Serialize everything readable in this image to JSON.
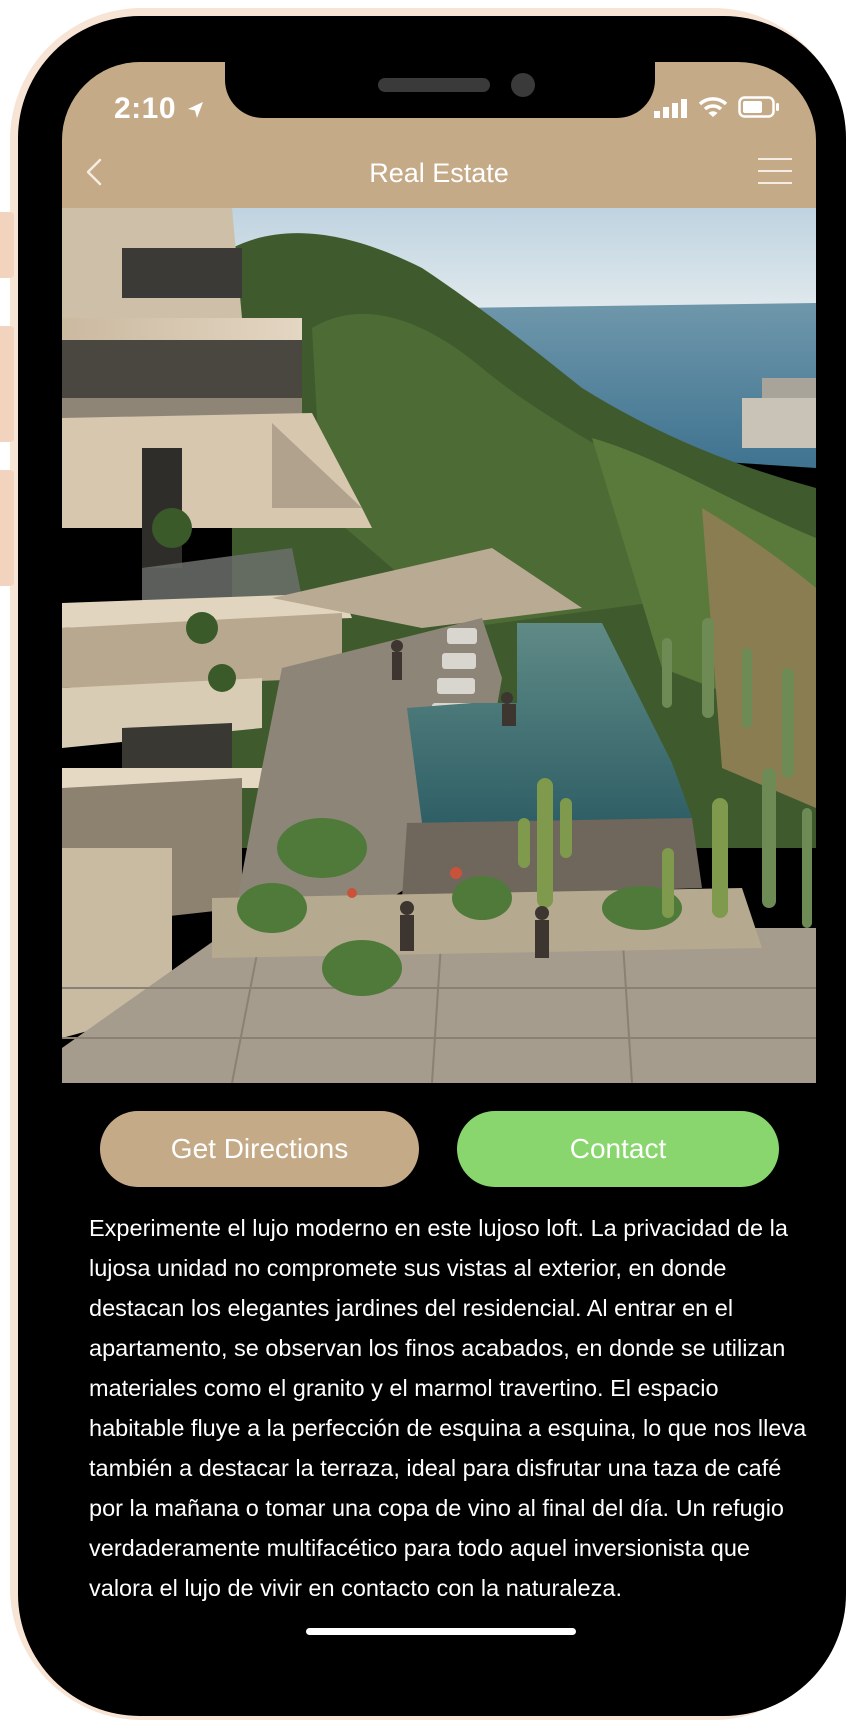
{
  "status_bar": {
    "time": "2:10"
  },
  "nav": {
    "title": "Real Estate"
  },
  "actions": {
    "directions_label": "Get Directions",
    "contact_label": "Contact"
  },
  "description": "Experimente el lujo moderno en este lujoso loft. La privacidad de la lujosa unidad no compromete sus vistas al exterior, en donde destacan los elegantes jardines del residencial. Al entrar en el apartamento, se observan los finos acabados, en donde se utilizan materiales como el granito y el marmol travertino. El espacio habitable fluye a la perfección de esquina a esquina, lo que nos lleva también a destacar la terraza, ideal para disfrutar una taza de café por la mañana o tomar una copa de vino al final del día. Un refugio verdaderamente multifacético para todo aquel inversionista que valora el lujo de vivir en contacto con la naturaleza.",
  "colors": {
    "accent_tan": "#c5aa88",
    "contact_green": "#88d66d",
    "frame_peach": "#f8e4d4"
  },
  "icons": [
    "back-chevron-icon",
    "hamburger-menu-icon",
    "location-arrow-icon",
    "signal-icon",
    "wifi-icon",
    "battery-icon"
  ]
}
